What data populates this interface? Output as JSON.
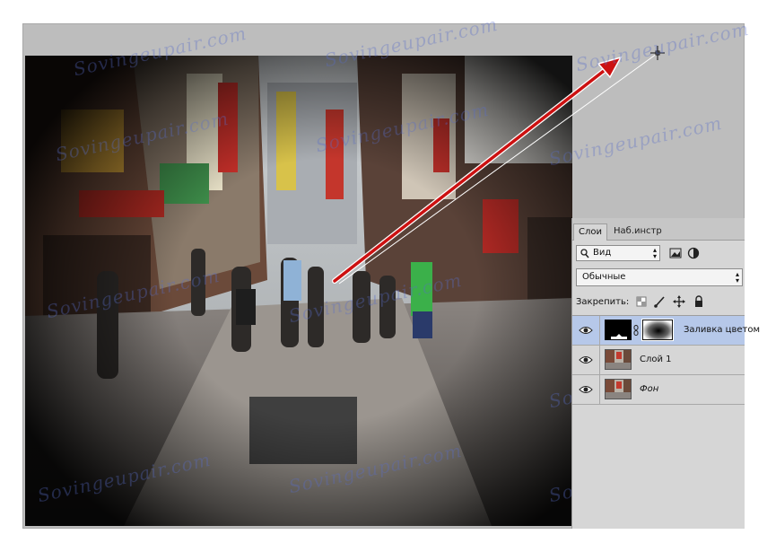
{
  "watermark": {
    "text": "Sovingeupair.com"
  },
  "layers_panel": {
    "tabs": [
      "Слои",
      "Наб.инстр"
    ],
    "filter": {
      "label": "Вид"
    },
    "blend_mode": "Обычные",
    "lock_label": "Закрепить:",
    "layers": [
      {
        "name": "Заливка цветом",
        "selected": true,
        "type": "fill-with-mask"
      },
      {
        "name": "Слой 1",
        "selected": false,
        "type": "image"
      },
      {
        "name": "Фон",
        "selected": false,
        "type": "image",
        "italic": true
      }
    ]
  },
  "colors": {
    "arrow": "#cc1111",
    "selected_layer": "#b6c8e9",
    "canvas_bg": "#bdbdbd"
  }
}
